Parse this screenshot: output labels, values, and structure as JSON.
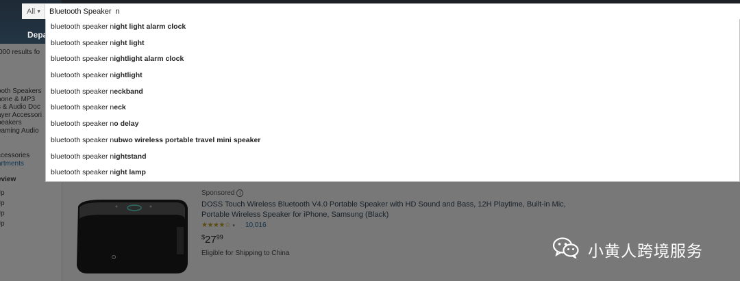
{
  "header": {
    "department_label": "Depa"
  },
  "search": {
    "category": "All",
    "query": "Bluetooth Speaker  n"
  },
  "suggestions": [
    {
      "prefix": "bluetooth speaker n",
      "completion": "ight light alarm clock"
    },
    {
      "prefix": "bluetooth speaker n",
      "completion": "ight light"
    },
    {
      "prefix": "bluetooth speaker n",
      "completion": "ightlight alarm clock"
    },
    {
      "prefix": "bluetooth speaker n",
      "completion": "ightlight"
    },
    {
      "prefix": "bluetooth speaker n",
      "completion": "eckband"
    },
    {
      "prefix": "bluetooth speaker n",
      "completion": "eck"
    },
    {
      "prefix": "bluetooth speaker n",
      "completion": "o delay"
    },
    {
      "prefix": "bluetooth speaker n",
      "completion": "ubwo wireless portable travel mini speaker"
    },
    {
      "prefix": "bluetooth speaker n",
      "completion": "ightstand"
    },
    {
      "prefix": "bluetooth speaker n",
      "completion": "ight lamp"
    }
  ],
  "sidebar": {
    "results_text": "000 results fo",
    "categories": [
      "ooth Speakers",
      "hone & MP3",
      "s & Audio Doc",
      "ayer Accessori",
      "peakers",
      "eaming Audio"
    ],
    "accessories": "ccessories",
    "departments_link": "artments",
    "review_heading": "eview",
    "review_items": [
      "Jp",
      "Jp",
      "Jp",
      "Jp"
    ]
  },
  "product": {
    "sponsored": "Sponsored",
    "title": "DOSS Touch Wireless Bluetooth V4.0 Portable Speaker with HD Sound and Bass, 12H Playtime, Built-in Mic, Portable Wireless Speaker for iPhone, Samsung (Black)",
    "stars": "★★★★☆",
    "review_count": "10,016",
    "price_symbol": "$",
    "price_whole": "27",
    "price_cents": "99",
    "shipping": "Eligible for Shipping to China"
  },
  "watermark": {
    "text": "小黄人跨境服务"
  }
}
